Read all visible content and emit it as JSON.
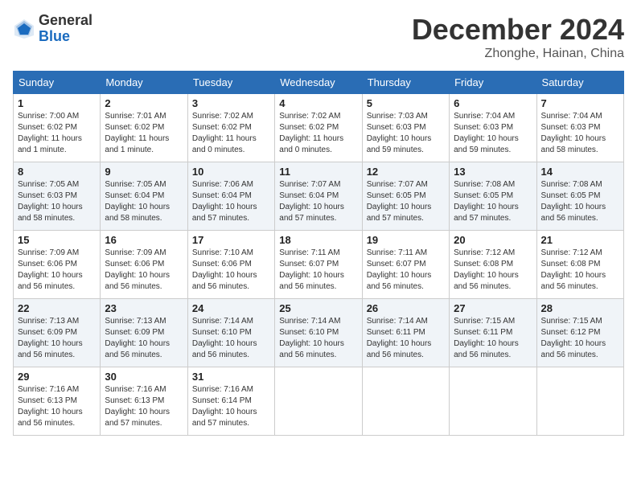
{
  "header": {
    "logo_general": "General",
    "logo_blue": "Blue",
    "title": "December 2024",
    "location": "Zhonghe, Hainan, China"
  },
  "days_of_week": [
    "Sunday",
    "Monday",
    "Tuesday",
    "Wednesday",
    "Thursday",
    "Friday",
    "Saturday"
  ],
  "weeks": [
    [
      {
        "day": "1",
        "info": "Sunrise: 7:00 AM\nSunset: 6:02 PM\nDaylight: 11 hours\nand 1 minute."
      },
      {
        "day": "2",
        "info": "Sunrise: 7:01 AM\nSunset: 6:02 PM\nDaylight: 11 hours\nand 1 minute."
      },
      {
        "day": "3",
        "info": "Sunrise: 7:02 AM\nSunset: 6:02 PM\nDaylight: 11 hours\nand 0 minutes."
      },
      {
        "day": "4",
        "info": "Sunrise: 7:02 AM\nSunset: 6:02 PM\nDaylight: 11 hours\nand 0 minutes."
      },
      {
        "day": "5",
        "info": "Sunrise: 7:03 AM\nSunset: 6:03 PM\nDaylight: 10 hours\nand 59 minutes."
      },
      {
        "day": "6",
        "info": "Sunrise: 7:04 AM\nSunset: 6:03 PM\nDaylight: 10 hours\nand 59 minutes."
      },
      {
        "day": "7",
        "info": "Sunrise: 7:04 AM\nSunset: 6:03 PM\nDaylight: 10 hours\nand 58 minutes."
      }
    ],
    [
      {
        "day": "8",
        "info": "Sunrise: 7:05 AM\nSunset: 6:03 PM\nDaylight: 10 hours\nand 58 minutes."
      },
      {
        "day": "9",
        "info": "Sunrise: 7:05 AM\nSunset: 6:04 PM\nDaylight: 10 hours\nand 58 minutes."
      },
      {
        "day": "10",
        "info": "Sunrise: 7:06 AM\nSunset: 6:04 PM\nDaylight: 10 hours\nand 57 minutes."
      },
      {
        "day": "11",
        "info": "Sunrise: 7:07 AM\nSunset: 6:04 PM\nDaylight: 10 hours\nand 57 minutes."
      },
      {
        "day": "12",
        "info": "Sunrise: 7:07 AM\nSunset: 6:05 PM\nDaylight: 10 hours\nand 57 minutes."
      },
      {
        "day": "13",
        "info": "Sunrise: 7:08 AM\nSunset: 6:05 PM\nDaylight: 10 hours\nand 57 minutes."
      },
      {
        "day": "14",
        "info": "Sunrise: 7:08 AM\nSunset: 6:05 PM\nDaylight: 10 hours\nand 56 minutes."
      }
    ],
    [
      {
        "day": "15",
        "info": "Sunrise: 7:09 AM\nSunset: 6:06 PM\nDaylight: 10 hours\nand 56 minutes."
      },
      {
        "day": "16",
        "info": "Sunrise: 7:09 AM\nSunset: 6:06 PM\nDaylight: 10 hours\nand 56 minutes."
      },
      {
        "day": "17",
        "info": "Sunrise: 7:10 AM\nSunset: 6:06 PM\nDaylight: 10 hours\nand 56 minutes."
      },
      {
        "day": "18",
        "info": "Sunrise: 7:11 AM\nSunset: 6:07 PM\nDaylight: 10 hours\nand 56 minutes."
      },
      {
        "day": "19",
        "info": "Sunrise: 7:11 AM\nSunset: 6:07 PM\nDaylight: 10 hours\nand 56 minutes."
      },
      {
        "day": "20",
        "info": "Sunrise: 7:12 AM\nSunset: 6:08 PM\nDaylight: 10 hours\nand 56 minutes."
      },
      {
        "day": "21",
        "info": "Sunrise: 7:12 AM\nSunset: 6:08 PM\nDaylight: 10 hours\nand 56 minutes."
      }
    ],
    [
      {
        "day": "22",
        "info": "Sunrise: 7:13 AM\nSunset: 6:09 PM\nDaylight: 10 hours\nand 56 minutes."
      },
      {
        "day": "23",
        "info": "Sunrise: 7:13 AM\nSunset: 6:09 PM\nDaylight: 10 hours\nand 56 minutes."
      },
      {
        "day": "24",
        "info": "Sunrise: 7:14 AM\nSunset: 6:10 PM\nDaylight: 10 hours\nand 56 minutes."
      },
      {
        "day": "25",
        "info": "Sunrise: 7:14 AM\nSunset: 6:10 PM\nDaylight: 10 hours\nand 56 minutes."
      },
      {
        "day": "26",
        "info": "Sunrise: 7:14 AM\nSunset: 6:11 PM\nDaylight: 10 hours\nand 56 minutes."
      },
      {
        "day": "27",
        "info": "Sunrise: 7:15 AM\nSunset: 6:11 PM\nDaylight: 10 hours\nand 56 minutes."
      },
      {
        "day": "28",
        "info": "Sunrise: 7:15 AM\nSunset: 6:12 PM\nDaylight: 10 hours\nand 56 minutes."
      }
    ],
    [
      {
        "day": "29",
        "info": "Sunrise: 7:16 AM\nSunset: 6:13 PM\nDaylight: 10 hours\nand 56 minutes."
      },
      {
        "day": "30",
        "info": "Sunrise: 7:16 AM\nSunset: 6:13 PM\nDaylight: 10 hours\nand 57 minutes."
      },
      {
        "day": "31",
        "info": "Sunrise: 7:16 AM\nSunset: 6:14 PM\nDaylight: 10 hours\nand 57 minutes."
      },
      null,
      null,
      null,
      null
    ]
  ]
}
